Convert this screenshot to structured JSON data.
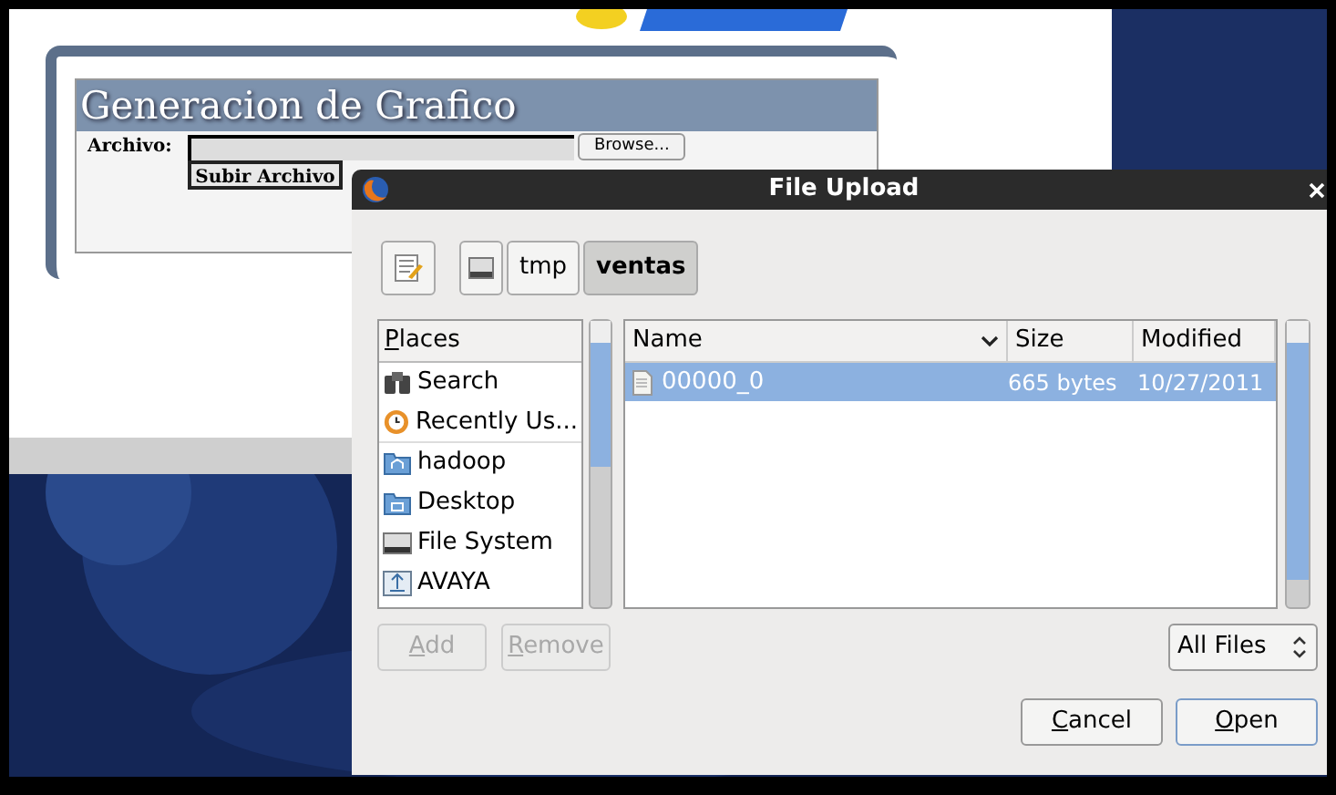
{
  "web_page": {
    "heading": "Generacion de Grafico",
    "file_label": "Archivo:",
    "browse_button": "Browse...",
    "submit_button": "Subir Archivo"
  },
  "dialog": {
    "title": "File Upload",
    "path": [
      {
        "label": "tmp",
        "selected": false
      },
      {
        "label": "ventas",
        "selected": true
      }
    ],
    "places_header": "Places",
    "places": [
      {
        "label": "Search",
        "kind": "search"
      },
      {
        "label": "Recently Us...",
        "kind": "recent"
      },
      {
        "label": "hadoop",
        "kind": "home"
      },
      {
        "label": "Desktop",
        "kind": "desktop"
      },
      {
        "label": "File System",
        "kind": "drive"
      },
      {
        "label": "AVAYA",
        "kind": "removable"
      }
    ],
    "columns": [
      "Name",
      "Size",
      "Modified"
    ],
    "files": [
      {
        "name": "00000_0",
        "size": "665 bytes",
        "modified": "10/27/2011",
        "selected": true
      }
    ],
    "add_button": {
      "label": "Add",
      "disabled": true
    },
    "remove_button": {
      "label": "Remove",
      "disabled": true
    },
    "filter": "All Files",
    "cancel_button": "Cancel",
    "open_button": "Open"
  }
}
